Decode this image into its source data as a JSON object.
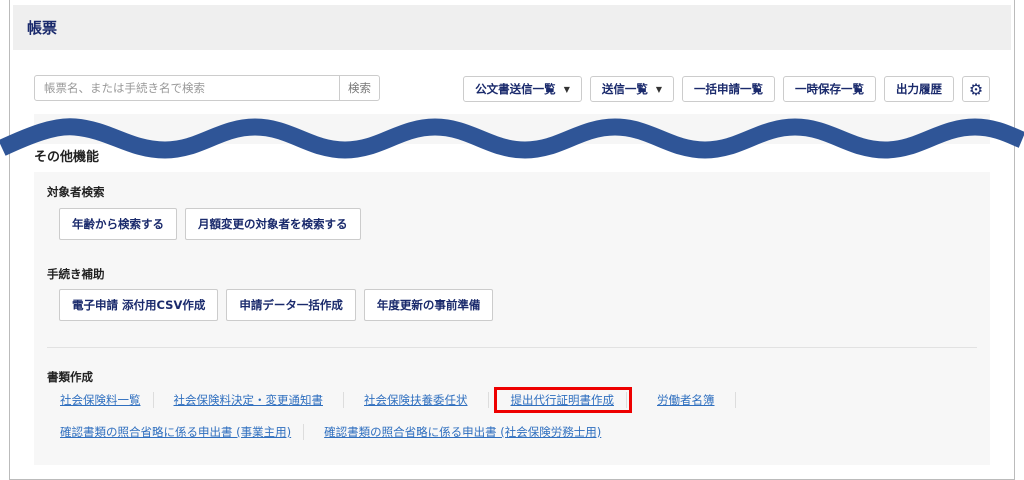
{
  "header": {
    "title": "帳票"
  },
  "search": {
    "placeholder": "帳票名、または手続き名で検索",
    "button": "検索"
  },
  "toolbar": {
    "items": [
      "公文書送信一覧",
      "送信一覧",
      "一括申請一覧",
      "一時保存一覧",
      "出力履歴"
    ],
    "settings_icon": "gear-icon"
  },
  "section_title": "その他機能",
  "groups": {
    "target_search": {
      "label": "対象者検索",
      "buttons": [
        "年齢から検索する",
        "月額変更の対象者を検索する"
      ]
    },
    "procedure_help": {
      "label": "手続き補助",
      "buttons": [
        "電子申請 添付用CSV作成",
        "申請データ一括作成",
        "年度更新の事前準備"
      ]
    },
    "documents": {
      "label": "書類作成",
      "links": [
        "社会保険料一覧",
        "社会保険料決定・変更通知書",
        "社会保険扶養委任状",
        "提出代行証明書作成",
        "労働者名簿",
        "確認書類の照合省略に係る申出書 (事業主用)",
        "確認書類の照合省略に係る申出書 (社会保険労務士用)"
      ]
    }
  },
  "colors": {
    "accent": "#1a2a6c",
    "wave": "#2f5597",
    "highlight": "#e00000",
    "link": "#2f6fbf"
  }
}
